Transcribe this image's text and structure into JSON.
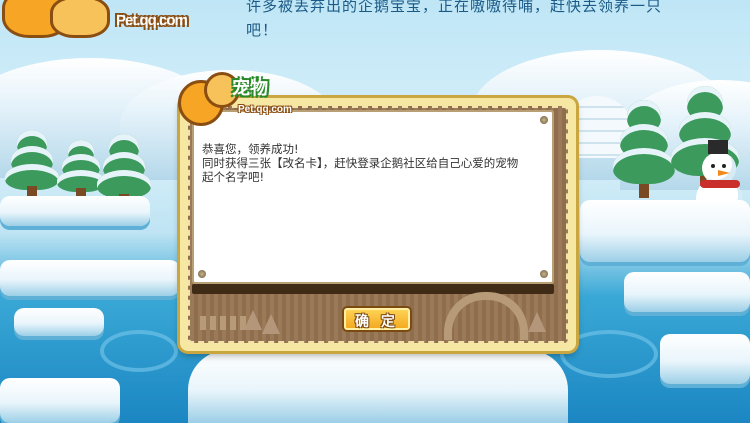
{
  "header": {
    "line1": "许多被丢弃出的企鹅宝宝，正在嗷嗷待哺，赶快去领养一只",
    "line2": "吧！"
  },
  "logo": {
    "domain": "Pet.qq.com"
  },
  "dialog": {
    "logo_title": "宠物",
    "logo_domain": "Pet.qq.com",
    "message_lines": [
      "恭喜您，领养成功!",
      "同时获得三张【改名卡】，赶快登录企鹅社区给自己心爱的宠物",
      "起个名字吧!"
    ],
    "confirm_label": "确 定"
  },
  "colors": {
    "accent_button": "#f3a51b",
    "dialog_frame": "#f6e8a3",
    "wood": "#9b7a5a"
  }
}
